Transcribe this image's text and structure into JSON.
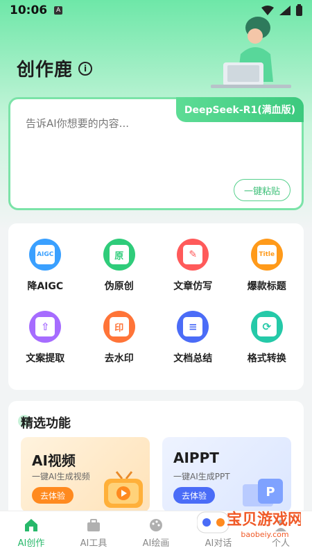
{
  "status": {
    "time": "10:06",
    "notif_badge": "A"
  },
  "header": {
    "title": "创作鹿",
    "info_icon": "info-icon"
  },
  "prompt": {
    "model_badge": "DeepSeek-R1(满血版)",
    "placeholder": "告诉AI你想要的内容...",
    "paste_label": "一键粘贴"
  },
  "tools": [
    {
      "label": "降AIGC",
      "icon": "aigc-reduce-icon",
      "icon_text": "AIGC",
      "color": "#3aa0ff"
    },
    {
      "label": "伪原创",
      "icon": "pseudo-original-icon",
      "icon_text": "原",
      "color": "#2fcc7a"
    },
    {
      "label": "文章仿写",
      "icon": "article-rewrite-icon",
      "icon_text": "✎",
      "color": "#ff5a5a"
    },
    {
      "label": "爆款标题",
      "icon": "hot-title-icon",
      "icon_text": "Title",
      "color": "#ff9a1a"
    },
    {
      "label": "文案提取",
      "icon": "text-extract-icon",
      "icon_text": "⇧",
      "color": "#a66cff"
    },
    {
      "label": "去水印",
      "icon": "remove-watermark-icon",
      "icon_text": "印",
      "color": "#ff7438"
    },
    {
      "label": "文档总结",
      "icon": "doc-summary-icon",
      "icon_text": "≡",
      "color": "#4b6cf7"
    },
    {
      "label": "格式转换",
      "icon": "format-convert-icon",
      "icon_text": "⟳",
      "color": "#25c9a8"
    }
  ],
  "featured": {
    "title": "精选功能",
    "items": [
      {
        "name": "AI视频",
        "desc": "一键AI生成视频",
        "button": "去体验"
      },
      {
        "name": "AIPPT",
        "desc": "一键AI生成PPT",
        "button": "去体验"
      }
    ]
  },
  "nav": [
    {
      "label": "AI创作",
      "icon": "home-icon",
      "active": true
    },
    {
      "label": "AI工具",
      "icon": "toolbox-icon",
      "active": false
    },
    {
      "label": "AI绘画",
      "icon": "palette-icon",
      "active": false
    },
    {
      "label": "AI对话",
      "icon": "chat-icon",
      "active": false
    },
    {
      "label": "个人",
      "icon": "profile-icon",
      "active": false
    }
  ],
  "watermark": {
    "name": "宝贝游戏网",
    "url": "baobeiy.com"
  },
  "colors": {
    "accent": "#27b86a",
    "badge": "#3cc97e"
  }
}
